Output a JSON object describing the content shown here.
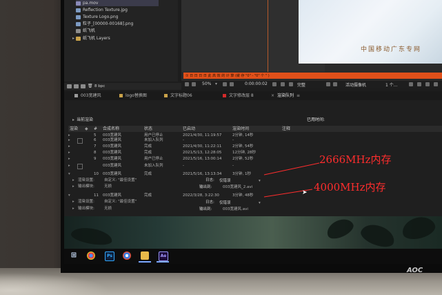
{
  "project": {
    "items": [
      {
        "label": "pa.mov",
        "color": "#8a8ab8",
        "selected": true
      },
      {
        "label": "Reflection Texture.jpg",
        "color": "#7d9bc3"
      },
      {
        "label": "Texture Logo.png",
        "color": "#7d9bc3"
      },
      {
        "label": "粒子_[00000-00168].png",
        "color": "#7d9bc3"
      },
      {
        "label": "纸飞机",
        "color": "#8c8c8c"
      },
      {
        "label": "纸飞机 Layers",
        "color": "#c9a24a"
      }
    ],
    "bit_depth": "8 bpc"
  },
  "preview": {
    "text": "中国移动广东专网"
  },
  "warning_bar": {
    "text": "① 日 日 日 日 此 高 效 的 计 算 (缓 存 \"0\" - \"0\" 个 \" )"
  },
  "viewer": {
    "zoom": "50%",
    "timecode": "0:00:00:02",
    "quality": "完整",
    "camera": "活动摄像机",
    "views": "1 个..."
  },
  "tabs": [
    {
      "label": "003宽建风",
      "color": "#9b9b9b"
    },
    {
      "label": "logo替换图",
      "color": "#c9a24a"
    },
    {
      "label": "文字标题06",
      "color": "#c9a24a"
    },
    {
      "label": "文字修改层 8",
      "color": "#d32a2a"
    },
    {
      "label": "渲染队列",
      "active": true
    }
  ],
  "render_queue": {
    "current_label": "当前渲染",
    "elapsed_label": "已用时间:",
    "headers": {
      "render": "渲染",
      "tag": "#",
      "comp": "合成名称",
      "status": "状态",
      "started": "已启动",
      "render_time": "渲染时间",
      "comment": "注释"
    },
    "rows": [
      {
        "num": "5",
        "name": "003宽建风",
        "status": "用户已停止",
        "started": "2021/4/30, 11:19:57",
        "time": "2分钟, 14秒"
      },
      {
        "num": "6",
        "name": "003宽建风",
        "status": "未加入队列",
        "started": "-",
        "time": "-"
      },
      {
        "num": "7",
        "name": "003宽建风",
        "status": "完成",
        "started": "2021/4/30, 11:22:11",
        "time": "2分钟, 54秒"
      },
      {
        "num": "8",
        "name": "003宽建风",
        "status": "完成",
        "started": "2021/5/13, 12:28:05",
        "time": "12分钟, 28秒"
      },
      {
        "num": "9",
        "name": "003宽建风",
        "status": "用户已停止",
        "started": "2021/5/16, 13:00:14",
        "time": "2分钟, 52秒"
      },
      {
        "num": "",
        "name": "003宽建风",
        "status": "未加入队列",
        "started": "-",
        "time": "-"
      },
      {
        "num": "10",
        "name": "003宽建风",
        "status": "完成",
        "started": "2021/5/16, 13:13:34",
        "time": "3分钟, 1秒"
      }
    ],
    "detail1": {
      "render_settings_label": "渲染设置:",
      "render_settings_value": "自定义: \"最佳设置\"",
      "log_label": "日志:",
      "log_value": "仅错误",
      "output_label": "输出模块:",
      "output_value": "无损",
      "output_to_label": "输出到:",
      "output_to_value": "003宽建风_2.avi"
    },
    "row11": {
      "num": "11",
      "name": "003宽建风",
      "status": "完成",
      "started": "2022/3/28, 3:22:30",
      "time": "3分钟, 48秒"
    },
    "detail2": {
      "render_settings_label": "渲染设置:",
      "render_settings_value": "自定义: \"最佳设置\"",
      "log_label": "日志:",
      "log_value": "仅错误",
      "output_label": "输出模块:",
      "output_value": "无损",
      "output_to_label": "输出到:",
      "output_to_value": "003宽建风.avi"
    }
  },
  "annotations": {
    "first": "2666MHz内存",
    "second": "4000MHz内存",
    "color": "#ff2d2d"
  },
  "taskbar": {
    "icons": [
      "windows-icon",
      "chrome-icon",
      "photoshop-icon",
      "browser-icon",
      "file-explorer-icon",
      "after-effects-icon"
    ]
  },
  "monitor": {
    "brand": "AOC"
  }
}
